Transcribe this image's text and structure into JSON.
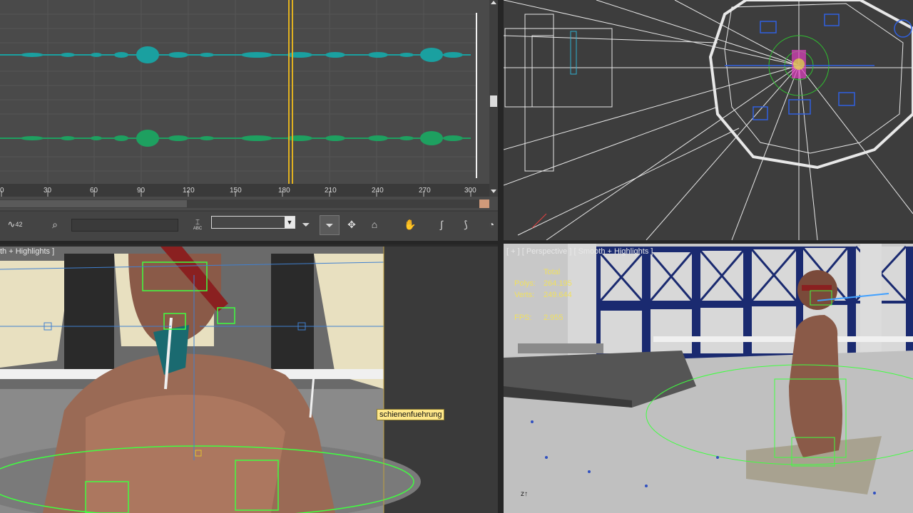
{
  "track_view": {
    "ruler_ticks": [
      "0",
      "30",
      "60",
      "90",
      "120",
      "150",
      "180",
      "210",
      "240",
      "270",
      "300"
    ]
  },
  "toolbar": {
    "curve_label": "42",
    "abc_label": "ABC",
    "dropdown_value": ""
  },
  "viewports": {
    "left_label": "th + Highlights ]",
    "perspective_label": "[ + ] [ Perspective ] [ Smooth + Highlights ]"
  },
  "stats": {
    "total_label": "Total",
    "polys_label": "Polys:",
    "polys_value": "264.195",
    "verts_label": "Verts:",
    "verts_value": "249.644",
    "fps_label": "FPS:",
    "fps_value": "2.955"
  },
  "tooltip": {
    "text": "schienenfuehrung"
  },
  "colors": {
    "wave_top": "#1aa0a0",
    "wave_bottom": "#1ea060",
    "playhead": "#e0b020",
    "selection": "#40ff40"
  }
}
